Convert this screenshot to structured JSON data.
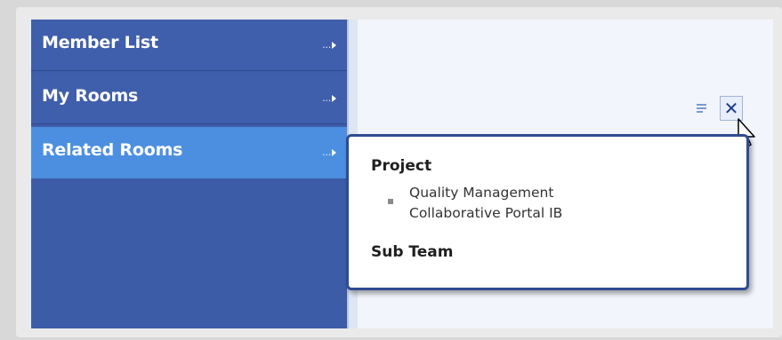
{
  "sidebar": {
    "items": [
      {
        "label": "Member List",
        "more": "..."
      },
      {
        "label": "My Rooms",
        "more": "..."
      },
      {
        "label": "Related Rooms",
        "more": "..."
      }
    ],
    "selected": "Related Rooms"
  },
  "toolbar": {
    "menu_icon": "list-menu-icon",
    "close_icon": "close-x-icon",
    "close_glyph": "✕"
  },
  "popup": {
    "section1_title": "Project",
    "rooms": [
      "Quality Management",
      "Collaborative Portal IB"
    ],
    "section2_title": "Sub Team"
  },
  "colors": {
    "sidebar": "#3d5ca8",
    "selected": "#4c8fe0",
    "popup_border": "#2f4b91"
  }
}
